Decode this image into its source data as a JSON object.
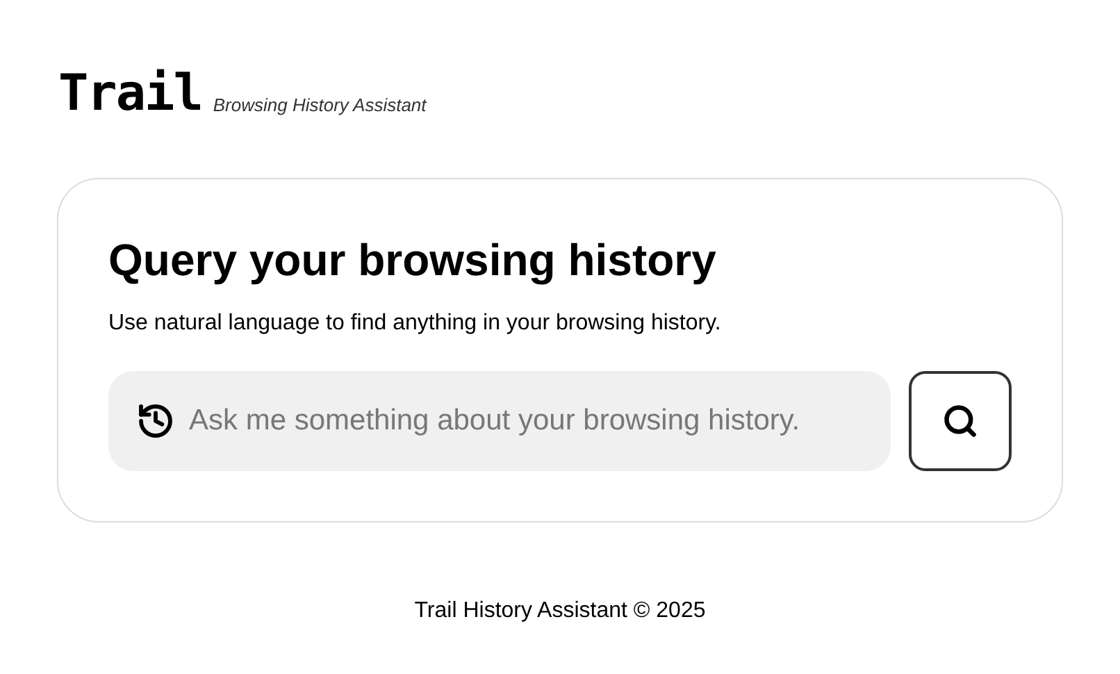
{
  "header": {
    "logo": "Trail",
    "tagline": "Browsing History Assistant"
  },
  "card": {
    "title": "Query your browsing history",
    "description": "Use natural language to find anything in your browsing history.",
    "search": {
      "placeholder": "Ask me something about your browsing history."
    }
  },
  "footer": "Trail History Assistant © 2025"
}
